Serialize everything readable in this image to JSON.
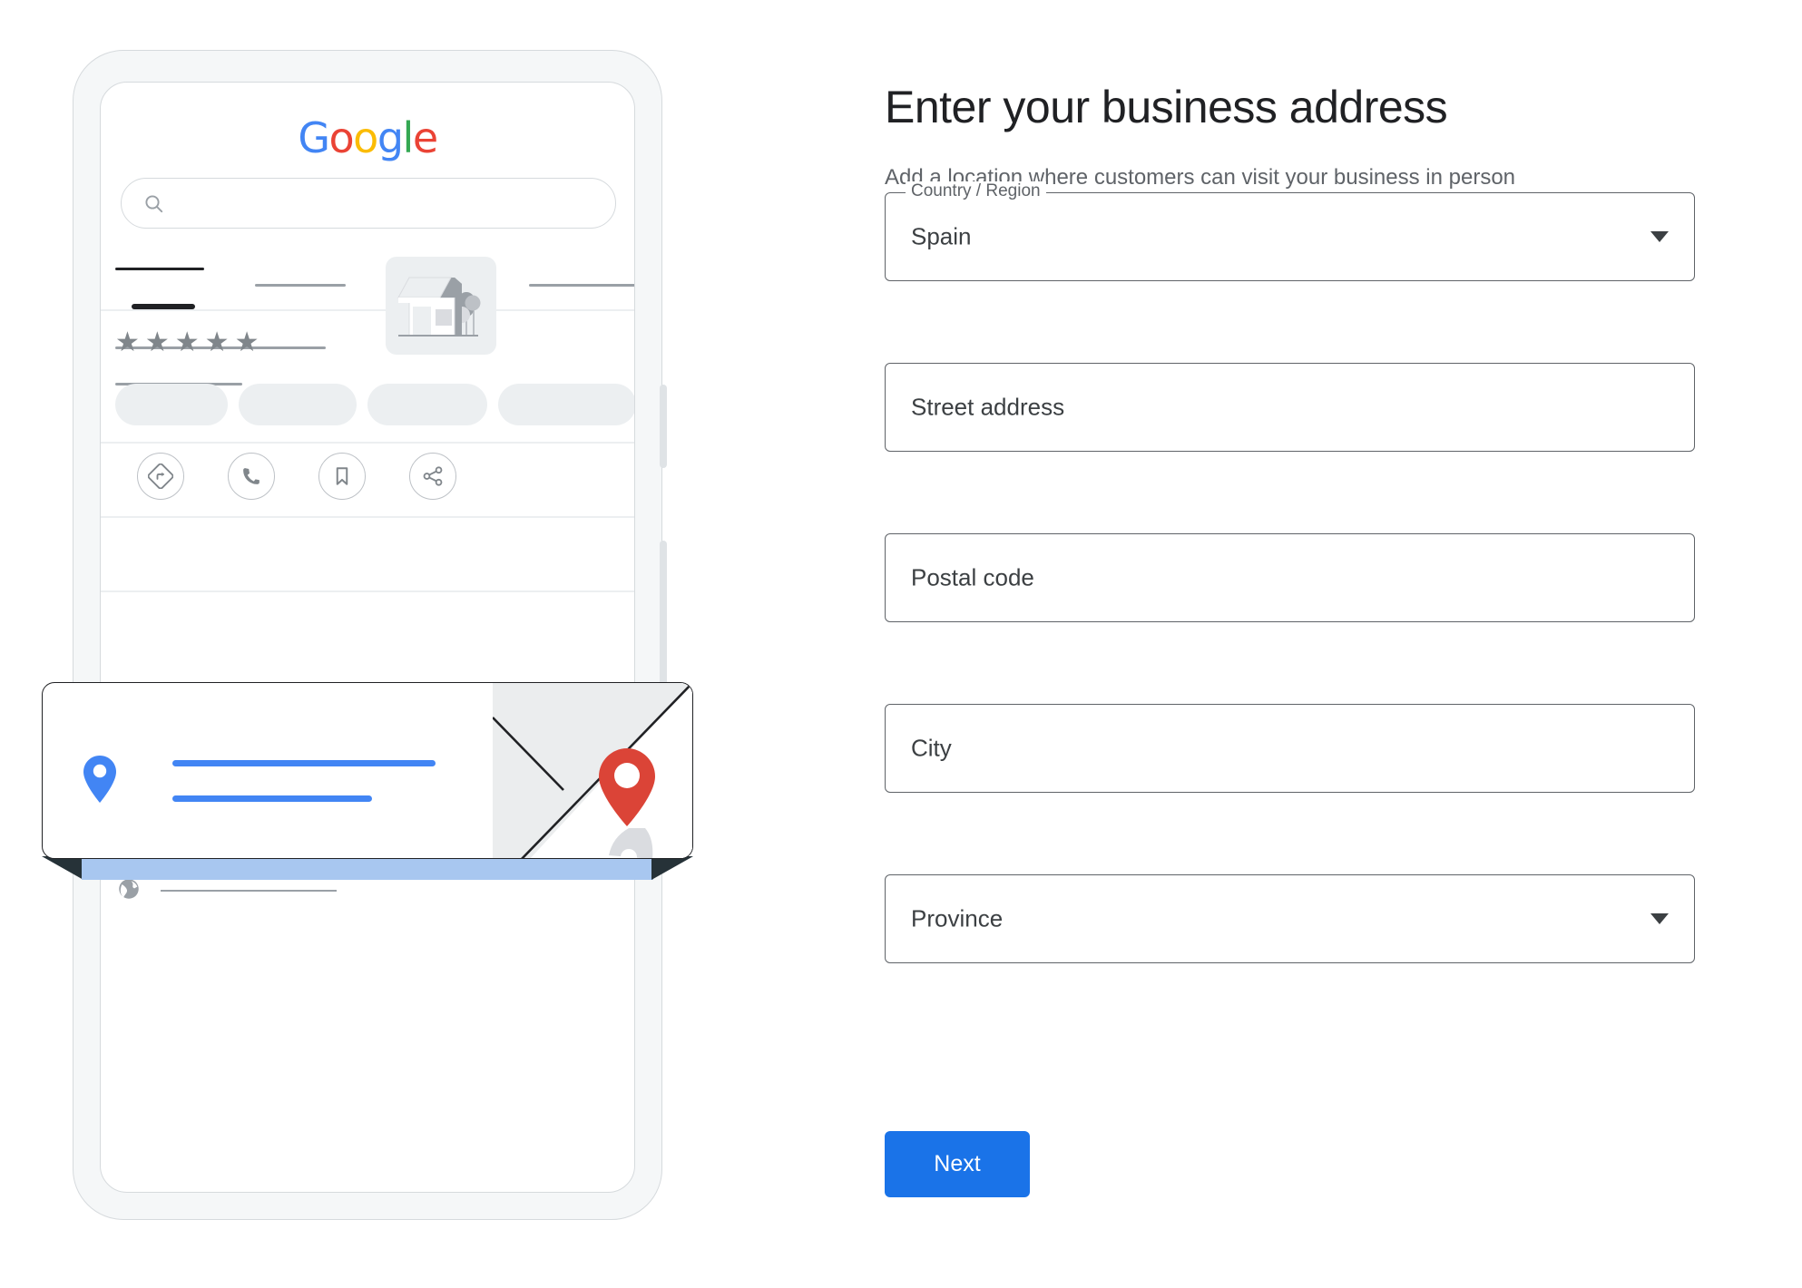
{
  "page": {
    "title": "Enter your business address",
    "subtitle": "Add a location where customers can visit your business in person"
  },
  "form": {
    "fields": [
      {
        "name": "country-region",
        "label": "Country / Region",
        "value": "Spain",
        "type": "select",
        "has_notch_label": true,
        "has_caret": true
      },
      {
        "name": "street-address",
        "label": "Street address",
        "value": "Street address",
        "type": "text",
        "has_notch_label": false,
        "has_caret": false
      },
      {
        "name": "postal-code",
        "label": "Postal code",
        "value": "Postal code",
        "type": "text",
        "has_notch_label": false,
        "has_caret": false
      },
      {
        "name": "city",
        "label": "City",
        "value": "City",
        "type": "text",
        "has_notch_label": false,
        "has_caret": false
      },
      {
        "name": "province",
        "label": "Province",
        "value": "Province",
        "type": "select",
        "has_notch_label": false,
        "has_caret": true
      }
    ],
    "submit_label": "Next"
  },
  "illustration": {
    "name": "phone-business-profile-mockup",
    "logo": {
      "letters": [
        {
          "char": "G",
          "color": "#4285f4"
        },
        {
          "char": "o",
          "color": "#ea4335"
        },
        {
          "char": "o",
          "color": "#fbbc05"
        },
        {
          "char": "g",
          "color": "#4285f4"
        },
        {
          "char": "l",
          "color": "#34a853"
        },
        {
          "char": "e",
          "color": "#ea4335"
        }
      ]
    },
    "search_icon": "search-icon",
    "rating_stars": "★★★★★",
    "star_count": 5,
    "action_icons": [
      "directions-icon",
      "call-icon",
      "bookmark-icon",
      "share-icon"
    ],
    "detail_rows": [
      "clock-icon",
      "phone-icon",
      "globe-icon"
    ],
    "address_card": {
      "pin_icon": "location-pin-icon",
      "map_pin_icon": "google-maps-pin-icon"
    }
  },
  "colors": {
    "accent": "#1a73e8",
    "maps_pin_red": "#db4437",
    "pin_blue": "#4285f4",
    "ribbon_band": "#a8c7f0",
    "ribbon_fold": "#263238",
    "text_primary": "#202124",
    "text_secondary": "#5f6368",
    "placeholder_gray": "#9aa0a6",
    "surface_gray": "#eceff1",
    "frame_gray": "#f5f7f8",
    "border_gray": "#d6dadd"
  }
}
